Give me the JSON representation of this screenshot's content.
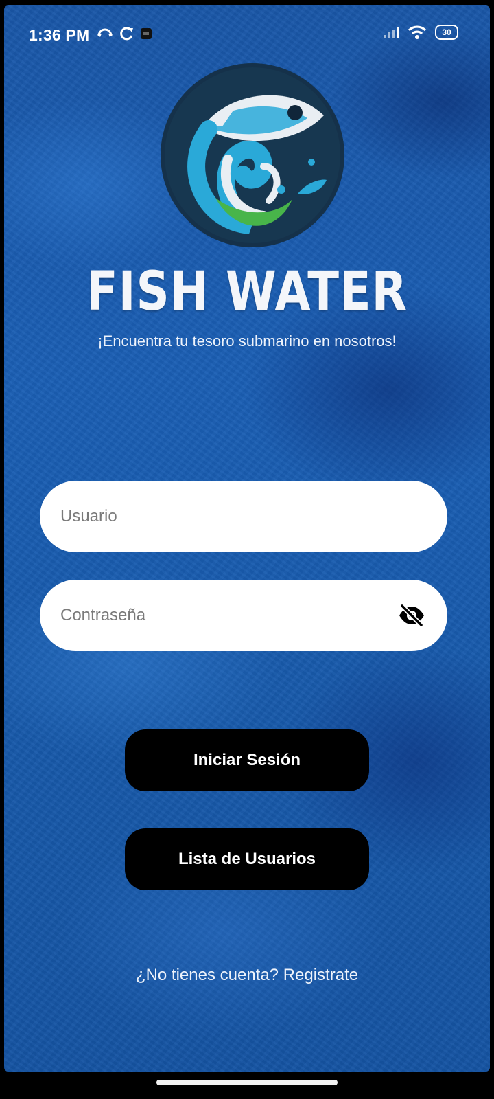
{
  "status_bar": {
    "time": "1:36 PM",
    "battery": "30"
  },
  "app": {
    "title": "FISH WATER",
    "tagline": "¡Encuentra tu tesoro submarino en nosotros!"
  },
  "form": {
    "username_placeholder": "Usuario",
    "password_placeholder": "Contraseña",
    "password_visibility_icon": "eye-off-icon"
  },
  "buttons": {
    "login_label": "Iniciar Sesión",
    "users_list_label": "Lista de Usuarios"
  },
  "register_link": "¿No tienes cuenta? Registrate",
  "colors": {
    "background": "#1b5fb5",
    "button": "#000000",
    "input": "#ffffff"
  }
}
